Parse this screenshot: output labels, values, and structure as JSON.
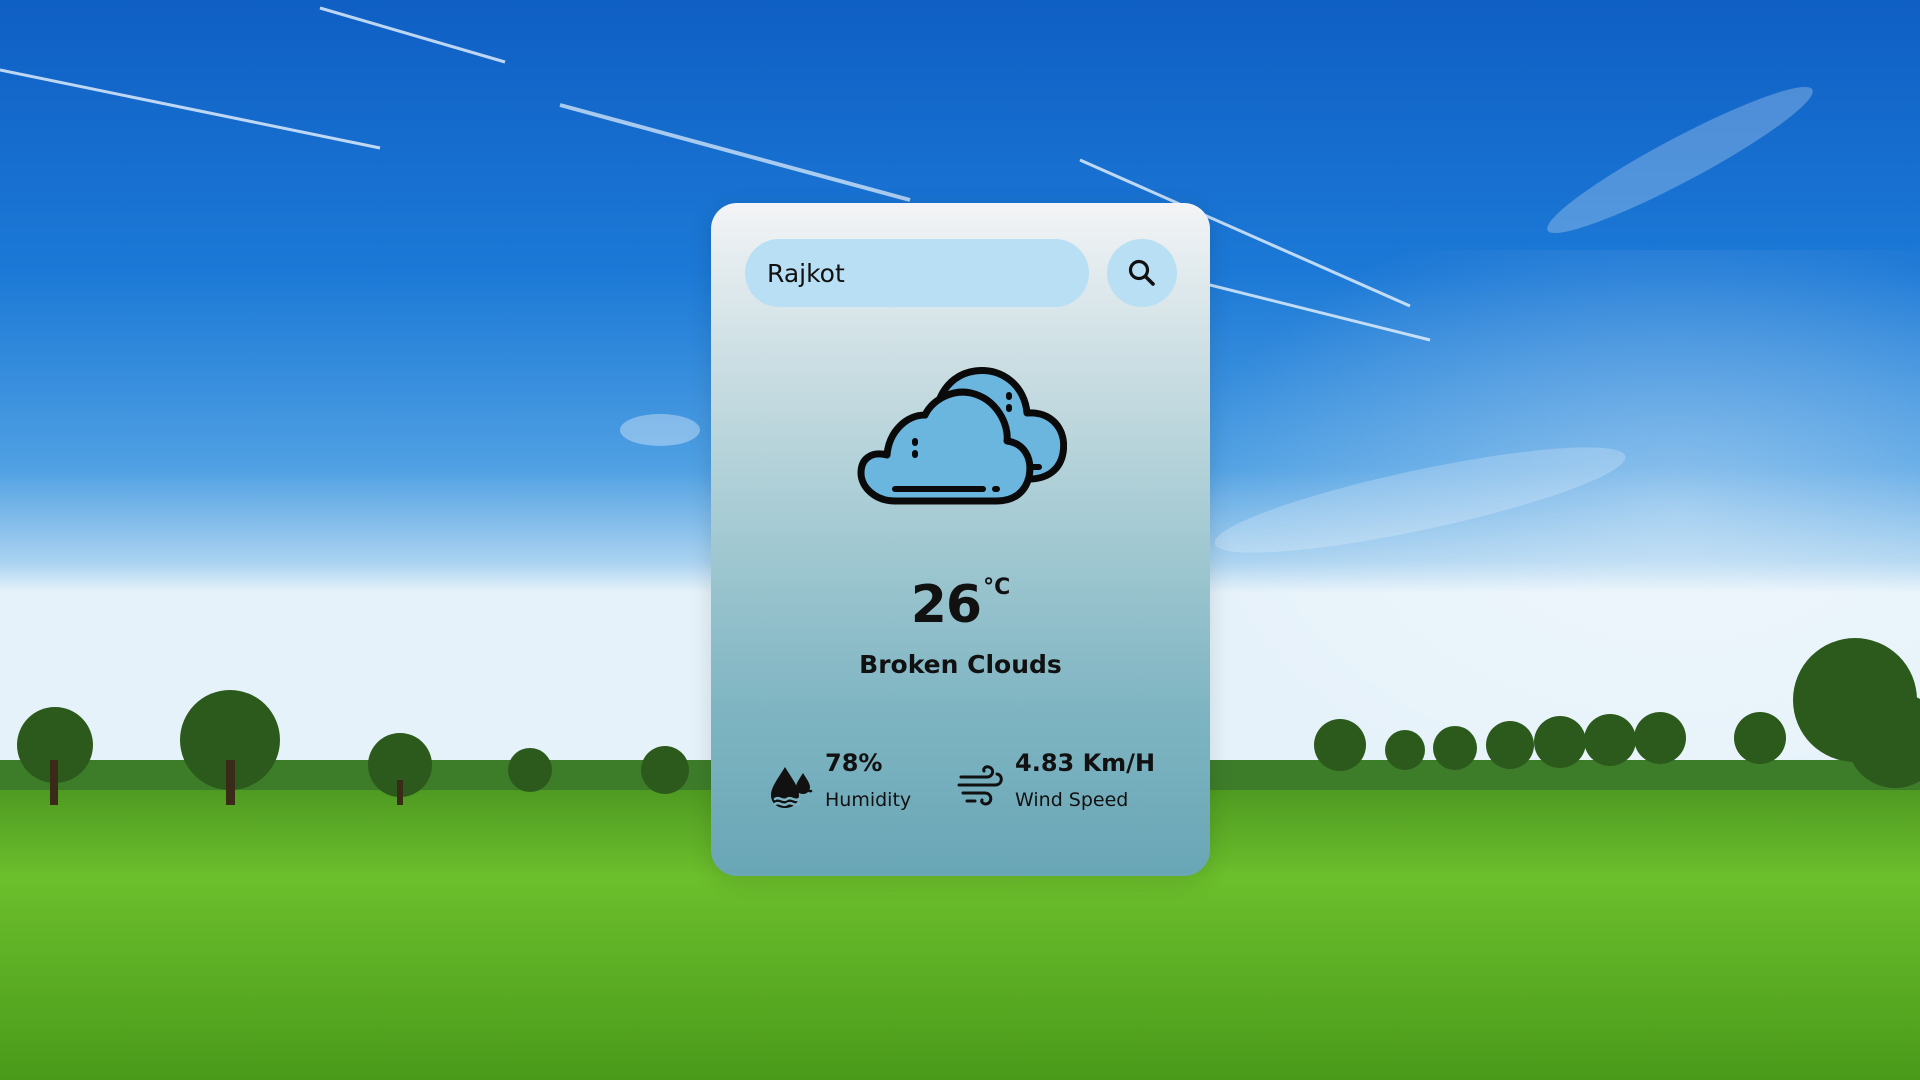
{
  "search": {
    "value": "Rajkot",
    "button_icon": "search-icon"
  },
  "weather": {
    "icon": "broken-clouds-icon",
    "temperature": "26",
    "unit": "°C",
    "description": "Broken Clouds"
  },
  "details": {
    "humidity": {
      "icon": "humidity-icon",
      "value": "78%",
      "label": "Humidity"
    },
    "wind": {
      "icon": "wind-icon",
      "value": "4.83 Km/H",
      "label": "Wind Speed"
    }
  },
  "colors": {
    "accent": "#b9dff4",
    "cloud_fill": "#6bb6df",
    "sky": "#1f7fd6",
    "grass": "#5aa820"
  }
}
